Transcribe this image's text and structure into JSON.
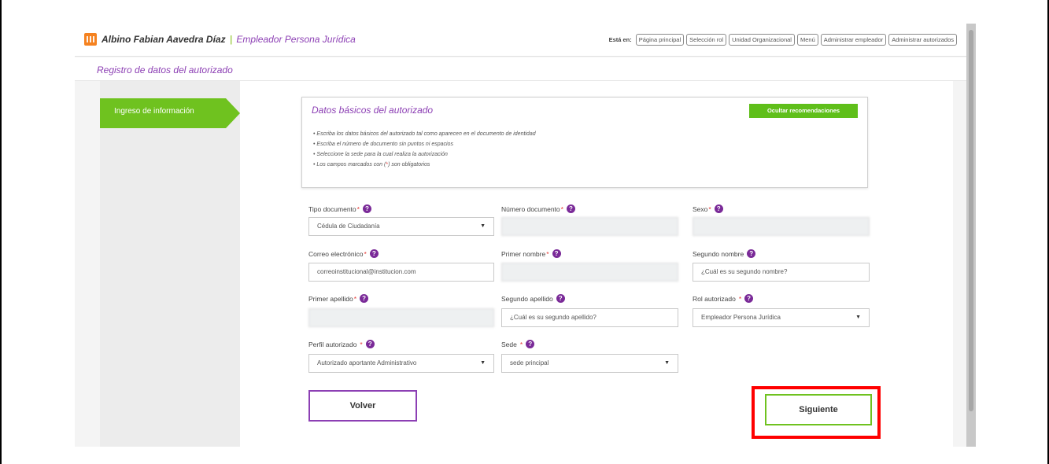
{
  "header": {
    "user_name": "Albino Fabian Aavedra Díaz",
    "separator": "|",
    "role_name": "Empleador Persona Jurídica",
    "breadcrumb_label": "Está en:",
    "breadcrumbs": [
      "Página principal",
      "Selección rol",
      "Unidad Organizacional",
      "Menú",
      "Administrar empleador",
      "Administrar autorizados"
    ]
  },
  "page_title": "Registro de datos del autorizado",
  "steps": {
    "current_label": "Ingreso de información"
  },
  "recommendations": {
    "title": "Datos básicos del autorizado",
    "hide_button_label": "Ocultar recomendaciones",
    "items": [
      "Escriba los datos básicos del autorizado tal como aparecen en el documento de identidad",
      "Escriba el número de documento sin puntos ni espacios",
      "Seleccione la sede para la cual realiza la autorización"
    ],
    "required_note": {
      "before": "Los campos marcados con (",
      "mark": "*",
      "after": ") son obligatorios"
    }
  },
  "form": {
    "tipo_documento": {
      "label": "Tipo documento",
      "value": "Cédula de Ciudadanía"
    },
    "numero_documento": {
      "label": "Número documento",
      "value": ""
    },
    "sexo": {
      "label": "Sexo",
      "value": ""
    },
    "correo": {
      "label": "Correo electrónico",
      "value": "correoinstitucional@institucion.com"
    },
    "primer_nombre": {
      "label": "Primer nombre",
      "value": ""
    },
    "segundo_nombre": {
      "label": "Segundo nombre",
      "placeholder": "¿Cuál es su segundo nombre?"
    },
    "primer_apellido": {
      "label": "Primer apellido",
      "value": ""
    },
    "segundo_apellido": {
      "label": "Segundo apellido",
      "placeholder": "¿Cuál es su segundo apellido?"
    },
    "rol_autorizado": {
      "label": "Rol autorizado",
      "value": "Empleador Persona Jurídica"
    },
    "perfil_autorizado": {
      "label": "Perfil autorizado",
      "value": "Autorizado aportante Administrativo"
    },
    "sede": {
      "label": "Sede",
      "value": "sede principal"
    },
    "required_star": "*",
    "help_glyph": "?"
  },
  "actions": {
    "back_label": "Volver",
    "next_label": "Siguiente"
  },
  "colors": {
    "accent_purple": "#8c3fb4",
    "accent_green": "#6fc21f",
    "highlight_red": "#ff0000",
    "logo_orange": "#f58220"
  },
  "icons": {
    "logo": "building-logo-icon",
    "help": "help-circle-icon",
    "dropdown": "chevron-down-icon"
  }
}
